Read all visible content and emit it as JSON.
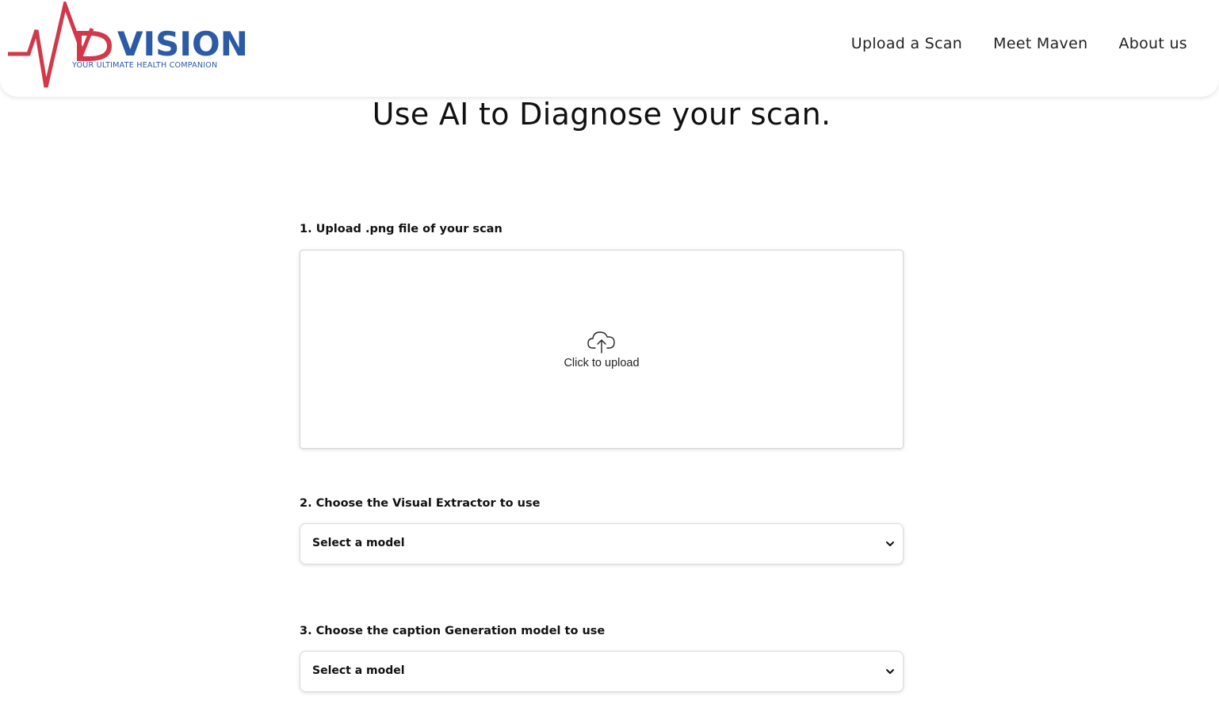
{
  "brand": {
    "name": "VISION",
    "tagline": "YOUR ULTIMATE HEALTH COMPANION",
    "colors": {
      "primary": "#2b5aa6",
      "accent": "#d2384a"
    }
  },
  "nav": {
    "items": [
      {
        "label": "Upload a Scan"
      },
      {
        "label": "Meet Maven"
      },
      {
        "label": "About us"
      }
    ]
  },
  "main": {
    "title": "Use AI to Diagnose your scan.",
    "upload": {
      "label": "1. Upload .png file of your scan",
      "prompt": "Click to upload",
      "icon": "cloud-upload-icon"
    },
    "visual_extractor": {
      "label": "2. Choose the Visual Extractor to use",
      "selected": "Select a model"
    },
    "caption_model": {
      "label": "3. Choose the caption Generation model to use",
      "selected": "Select a model"
    }
  }
}
